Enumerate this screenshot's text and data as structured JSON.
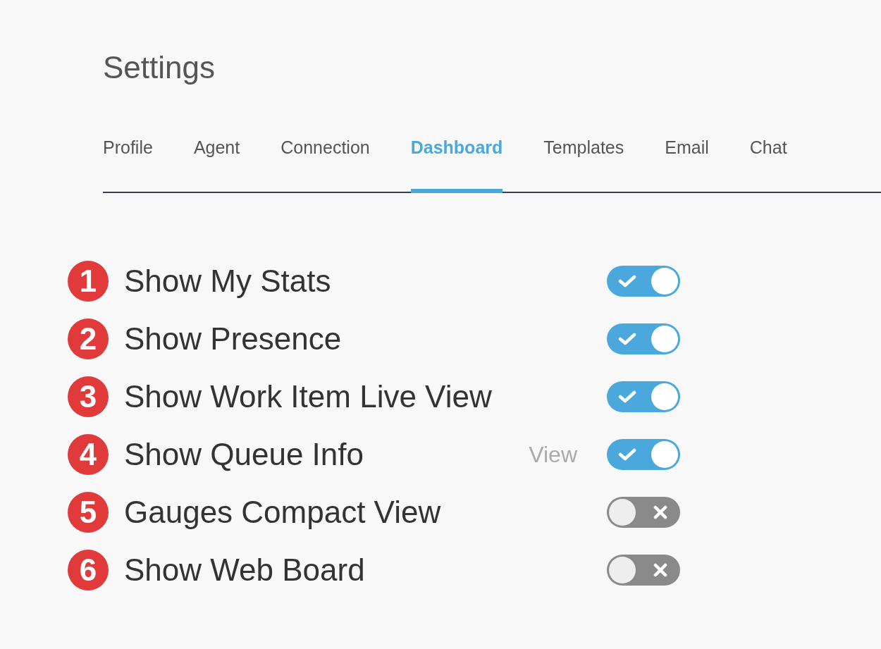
{
  "title": "Settings",
  "tabs": [
    {
      "label": "Profile",
      "selected": false
    },
    {
      "label": "Agent",
      "selected": false
    },
    {
      "label": "Connection",
      "selected": false
    },
    {
      "label": "Dashboard",
      "selected": true
    },
    {
      "label": "Templates",
      "selected": false
    },
    {
      "label": "Email",
      "selected": false
    },
    {
      "label": "Chat",
      "selected": false
    }
  ],
  "settings": [
    {
      "number": "1",
      "label": "Show My Stats",
      "on": true
    },
    {
      "number": "2",
      "label": "Show Presence",
      "on": true
    },
    {
      "number": "3",
      "label": "Show Work Item Live View",
      "on": true
    },
    {
      "number": "4",
      "label": "Show Queue Info",
      "link": "View",
      "on": true
    },
    {
      "number": "5",
      "label": "Gauges Compact View",
      "on": false
    },
    {
      "number": "6",
      "label": "Show Web Board",
      "on": false
    }
  ]
}
